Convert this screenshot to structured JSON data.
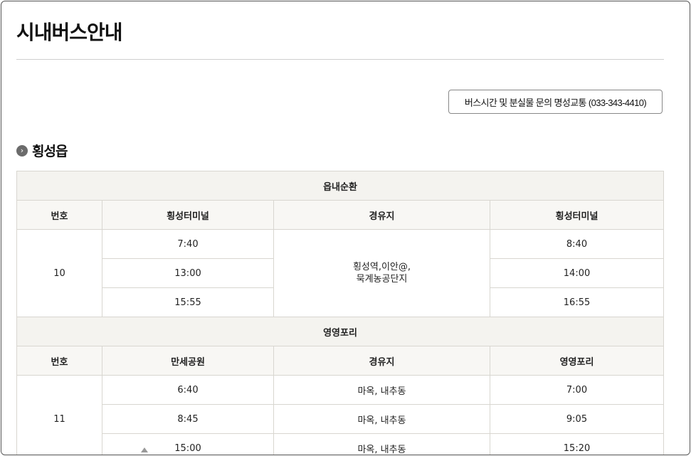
{
  "page": {
    "title": "시내버스안내",
    "contact_button": "버스시간 및 분실물 문의 명성교통 (033-343-4410)"
  },
  "section": {
    "title": "횡성읍",
    "icon": "chevron-right-circle-icon"
  },
  "routes": [
    {
      "name": "읍내순환",
      "headers": [
        "번호",
        "횡성터미널",
        "경유지",
        "횡성터미널"
      ],
      "number": "10",
      "via_line1": "횡성역,이안@,",
      "via_line2": "묵계농공단지",
      "departures": [
        "7:40",
        "13:00",
        "15:55"
      ],
      "arrivals": [
        "8:40",
        "14:00",
        "16:55"
      ]
    },
    {
      "name": "영영포리",
      "headers": [
        "번호",
        "만세공원",
        "경유지",
        "영영포리"
      ],
      "number": "11",
      "departures": [
        "6:40",
        "8:45",
        "15:00"
      ],
      "vias": [
        "마옥, 내추동",
        "마옥, 내추동",
        "마옥, 내추동"
      ],
      "arrivals": [
        "7:00",
        "9:05",
        "15:20"
      ]
    }
  ]
}
